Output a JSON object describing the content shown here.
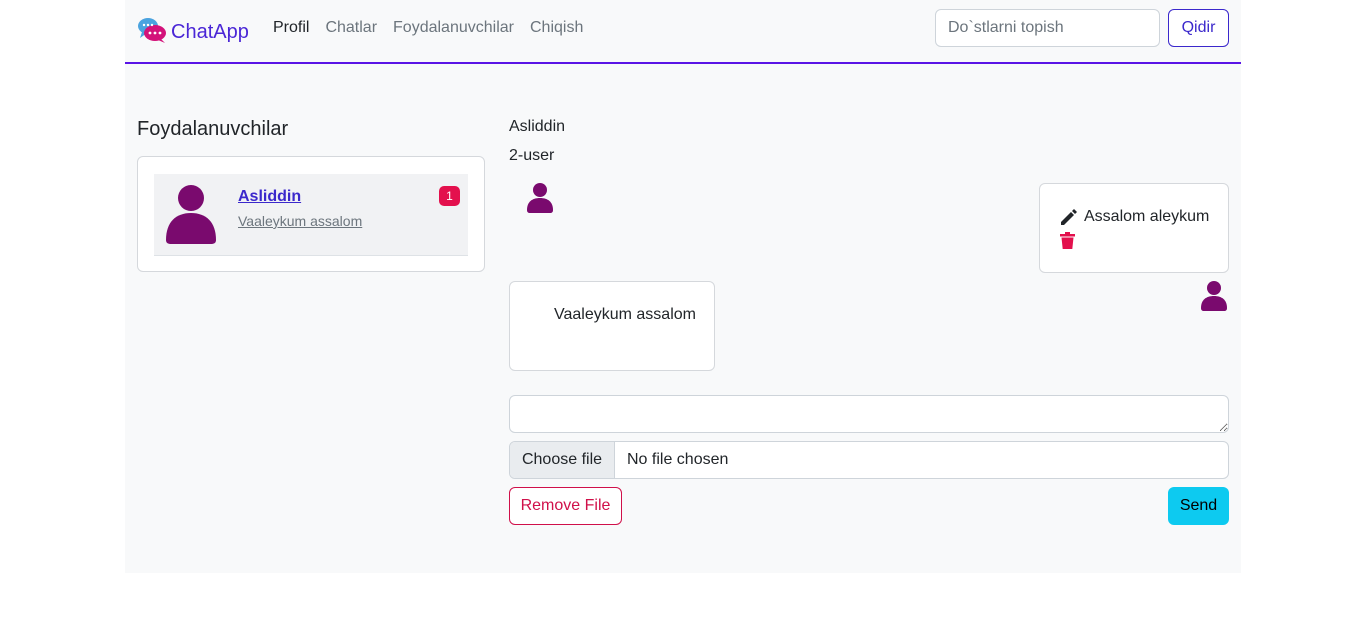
{
  "header": {
    "brand": "ChatApp",
    "nav": [
      "Profil",
      "Chatlar",
      "Foydalanuvchilar",
      "Chiqish"
    ],
    "search_placeholder": "Do`stlarni topish",
    "search_button": "Qidir"
  },
  "sidebar": {
    "title": "Foydalanuvchilar",
    "users": [
      {
        "name": "Asliddin",
        "last_message": "Vaaleykum assalom",
        "unread": "1"
      }
    ]
  },
  "chat": {
    "contact_name": "Asliddin",
    "contact_username": "2-user",
    "messages": [
      {
        "text": "Assalom aleykum",
        "own": true
      },
      {
        "text": "Vaaleykum assalom",
        "own": false
      }
    ]
  },
  "composer": {
    "choose_file": "Choose file",
    "file_status": "No file chosen",
    "remove_file": "Remove File",
    "send": "Send"
  },
  "colors": {
    "accent": "#4a26d6",
    "avatar": "#7a0a6e",
    "danger": "#e3104d",
    "send": "#0dcaf0"
  }
}
